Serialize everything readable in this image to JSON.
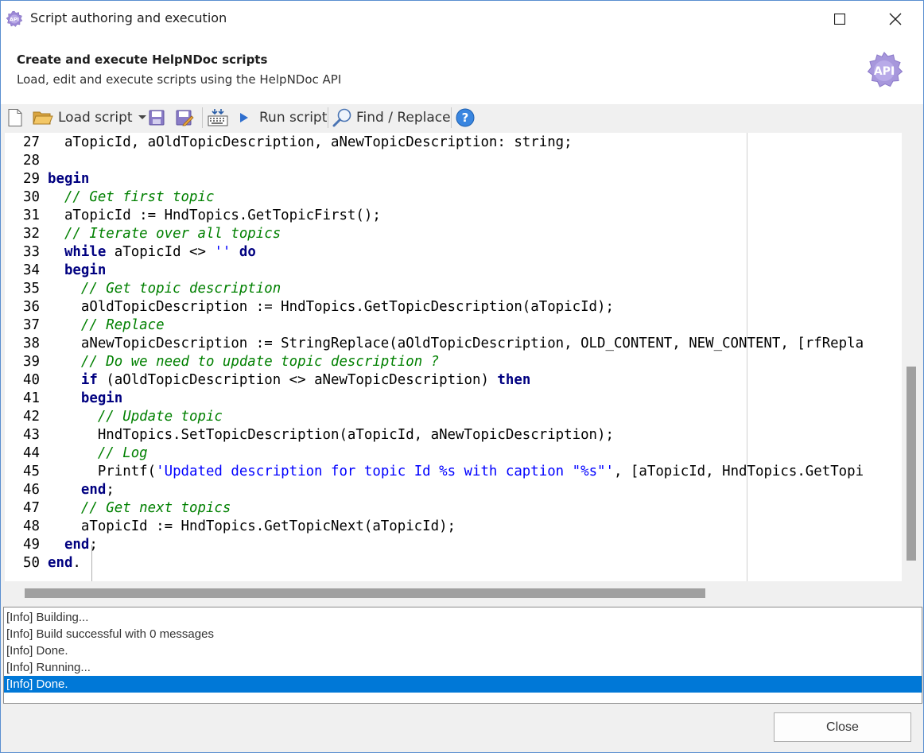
{
  "window": {
    "title": "Script authoring and execution",
    "icons": [
      "api-gear-icon",
      "maximize-icon",
      "close-icon"
    ]
  },
  "header": {
    "title": "Create and execute HelpNDoc scripts",
    "subtitle": "Load, edit and execute scripts using the HelpNDoc API",
    "logo_text": "API"
  },
  "toolbar": {
    "load_label": "Load script",
    "run_label": "Run script",
    "find_label": "Find / Replace",
    "icons": [
      "new-file-icon",
      "folder-open-icon",
      "dropdown-arrow-icon",
      "save-icon",
      "save-as-icon",
      "build-icon",
      "play-icon",
      "magnifier-icon",
      "help-icon"
    ]
  },
  "editor": {
    "lines": [
      {
        "n": "27",
        "text": "  aTopicId, aOldTopicDescription, aNewTopicDescription: string;"
      },
      {
        "n": "28",
        "text": ""
      },
      {
        "n": "29",
        "text": "begin"
      },
      {
        "n": "30",
        "text": "  // Get first topic"
      },
      {
        "n": "31",
        "text": "  aTopicId := HndTopics.GetTopicFirst();"
      },
      {
        "n": "32",
        "text": "  // Iterate over all topics"
      },
      {
        "n": "33",
        "text": "  while aTopicId <> '' do"
      },
      {
        "n": "34",
        "text": "  begin"
      },
      {
        "n": "35",
        "text": "    // Get topic description"
      },
      {
        "n": "36",
        "text": "    aOldTopicDescription := HndTopics.GetTopicDescription(aTopicId);"
      },
      {
        "n": "37",
        "text": "    // Replace"
      },
      {
        "n": "38",
        "text": "    aNewTopicDescription := StringReplace(aOldTopicDescription, OLD_CONTENT, NEW_CONTENT, [rfRepla"
      },
      {
        "n": "39",
        "text": "    // Do we need to update topic description ?"
      },
      {
        "n": "40",
        "text": "    if (aOldTopicDescription <> aNewTopicDescription) then"
      },
      {
        "n": "41",
        "text": "    begin"
      },
      {
        "n": "42",
        "text": "      // Update topic"
      },
      {
        "n": "43",
        "text": "      HndTopics.SetTopicDescription(aTopicId, aNewTopicDescription);"
      },
      {
        "n": "44",
        "text": "      // Log"
      },
      {
        "n": "45",
        "text": "      Printf('Updated description for topic Id %s with caption \"%s\"', [aTopicId, HndTopics.GetTopi"
      },
      {
        "n": "46",
        "text": "    end;"
      },
      {
        "n": "47",
        "text": "    // Get next topics"
      },
      {
        "n": "48",
        "text": "    aTopicId := HndTopics.GetTopicNext(aTopicId);"
      },
      {
        "n": "49",
        "text": "  end;"
      },
      {
        "n": "50",
        "text": "end."
      }
    ]
  },
  "log": {
    "lines": [
      "[Info] Building...",
      "[Info] Build successful with 0 messages",
      "[Info] Done.",
      "[Info] Running...",
      "[Info] Done."
    ],
    "selected_index": 4
  },
  "footer": {
    "close_label": "Close"
  },
  "colors": {
    "keyword": "#000080",
    "comment": "#008000",
    "string": "#0000ff",
    "selection": "#0078d7",
    "border": "#5a8fd0"
  }
}
